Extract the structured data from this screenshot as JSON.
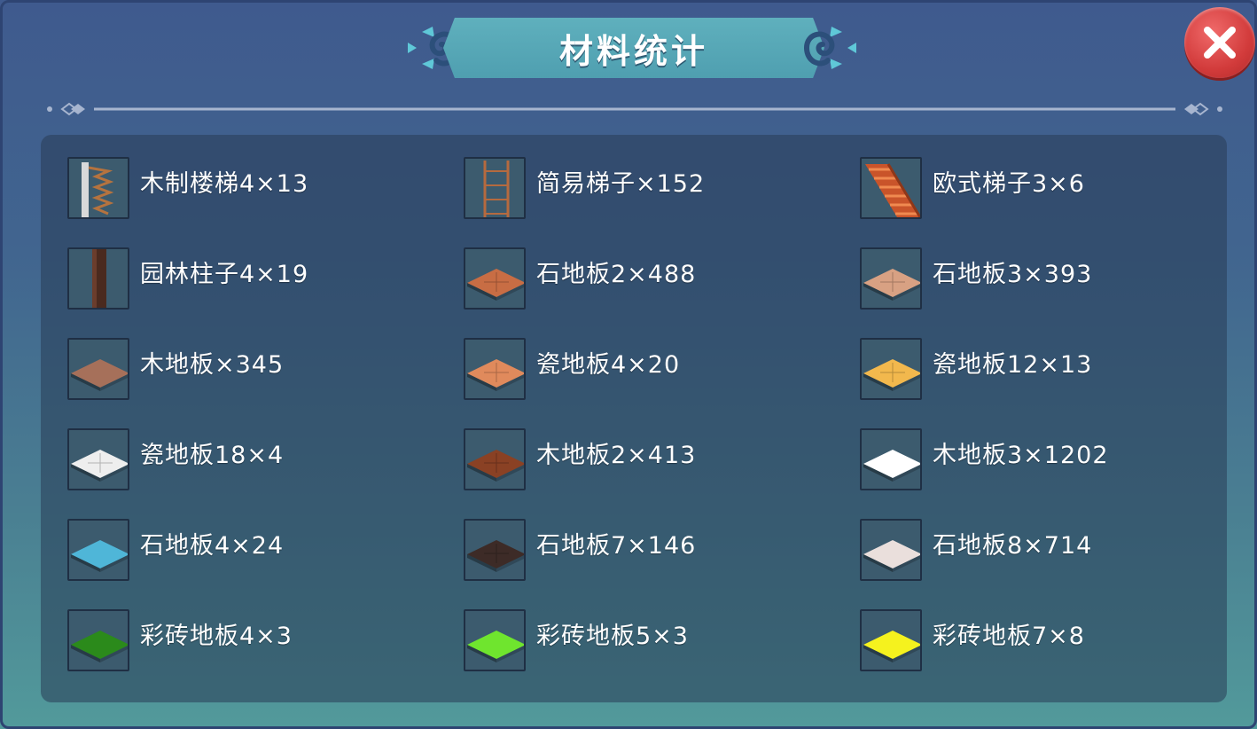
{
  "dialog": {
    "title": "材料统计"
  },
  "materials": [
    {
      "label": "木制楼梯4×13",
      "icon": "spiral-stair-icon"
    },
    {
      "label": "简易梯子×152",
      "icon": "ladder-icon"
    },
    {
      "label": "欧式梯子3×6",
      "icon": "euro-stair-icon"
    },
    {
      "label": "园林柱子4×19",
      "icon": "pillar-icon"
    },
    {
      "label": "石地板2×488",
      "icon": "floor-tile-icon",
      "color": "#c86d44"
    },
    {
      "label": "石地板3×393",
      "icon": "floor-tile-icon",
      "color": "#d8a183"
    },
    {
      "label": "木地板×345",
      "icon": "floor-tile-icon",
      "color": "#a6705a"
    },
    {
      "label": "瓷地板4×20",
      "icon": "floor-tile-icon",
      "color": "#e08a5c"
    },
    {
      "label": "瓷地板12×13",
      "icon": "floor-tile-icon",
      "color": "#f2b84d"
    },
    {
      "label": "瓷地板18×4",
      "icon": "floor-tile-icon",
      "color": "#eeeeee"
    },
    {
      "label": "木地板2×413",
      "icon": "floor-tile-icon",
      "color": "#8a4124"
    },
    {
      "label": "木地板3×1202",
      "icon": "floor-tile-icon",
      "color": "#ffffff"
    },
    {
      "label": "石地板4×24",
      "icon": "floor-tile-icon",
      "color": "#4fb6d8"
    },
    {
      "label": "石地板7×146",
      "icon": "floor-tile-icon",
      "color": "#3d2b27"
    },
    {
      "label": "石地板8×714",
      "icon": "floor-tile-icon",
      "color": "#eadfdc"
    },
    {
      "label": "彩砖地板4×3",
      "icon": "floor-tile-icon",
      "color": "#2b8a1b"
    },
    {
      "label": "彩砖地板5×3",
      "icon": "floor-tile-icon",
      "color": "#6fe52e"
    },
    {
      "label": "彩砖地板7×8",
      "icon": "floor-tile-icon",
      "color": "#f5f21e"
    }
  ],
  "colors": {
    "close_button": "#d23b3b",
    "title_banner": "#5fb0bd"
  }
}
